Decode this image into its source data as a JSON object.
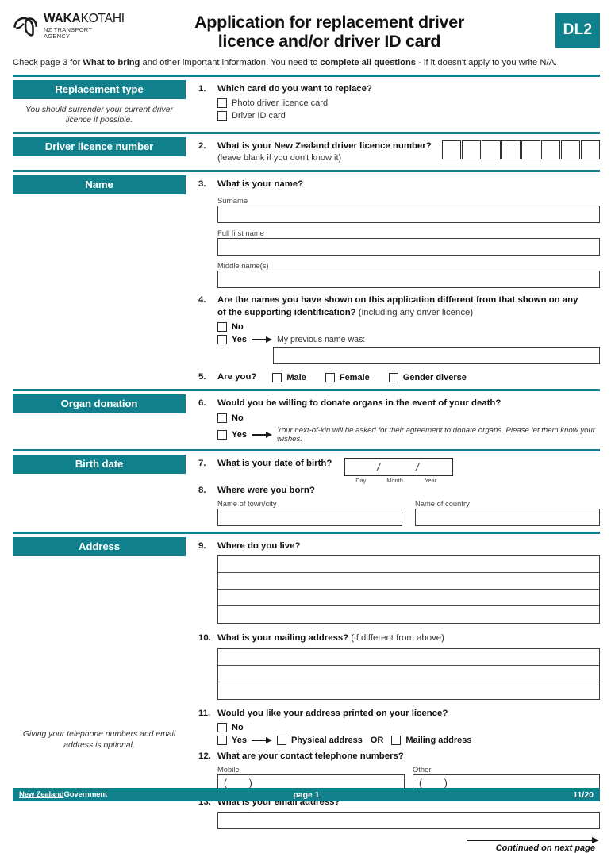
{
  "header": {
    "logo_primary": "WAKA",
    "logo_secondary": "KOTAHI",
    "logo_sub_line1": "NZ TRANSPORT",
    "logo_sub_line2": "AGENCY",
    "title_line1": "Application for replacement driver",
    "title_line2": "licence and/or driver ID card",
    "badge": "DL2",
    "intro_part1": "Check page 3 for ",
    "intro_bold1": "What to bring",
    "intro_part2": " and other important information. You need to ",
    "intro_bold2": "complete all questions",
    "intro_part3": " - if it doesn't apply to you write N/A."
  },
  "colors": {
    "teal": "#10808c",
    "box_border": "#3d3d3d",
    "text": "#1a1a1a"
  },
  "sections": {
    "replacement_type": {
      "tab": "Replacement type",
      "note": "You should surrender your current driver licence if possible."
    },
    "driver_licence_number": {
      "tab": "Driver licence number"
    },
    "name": {
      "tab": "Name"
    },
    "organ_donation": {
      "tab": "Organ donation"
    },
    "birth_date": {
      "tab": "Birth date"
    },
    "address": {
      "tab": "Address",
      "note": "Giving your telephone numbers and email address is optional."
    }
  },
  "questions": {
    "q1": {
      "num": "1.",
      "text": "Which card do you want to replace?",
      "options": [
        "Photo driver licence card",
        "Driver ID card"
      ]
    },
    "q2": {
      "num": "2.",
      "text": "What is your New Zealand driver licence number?",
      "sub": "(leave blank if you don't know it)",
      "box_count": 8
    },
    "q3": {
      "num": "3.",
      "text": "What is your name?",
      "labels": [
        "Surname",
        "Full first name",
        "Middle name(s)"
      ]
    },
    "q4": {
      "num": "4.",
      "text_line1": "Are the names you have shown on this application different from that shown on any",
      "text_line2_bold": "of the supporting identification?",
      "text_line2_reg": " (including any driver licence)",
      "option_no": "No",
      "option_yes": "Yes",
      "followup_label": "My previous name was:"
    },
    "q5": {
      "num": "5.",
      "text": "Are you?",
      "options": [
        "Male",
        "Female",
        "Gender diverse"
      ]
    },
    "q6": {
      "num": "6.",
      "text": "Would you be willing to donate organs in the event of your death?",
      "option_no": "No",
      "option_yes": "Yes",
      "yes_note": "Your next-of-kin will be asked for their agreement to donate organs. Please let them know your wishes."
    },
    "q7": {
      "num": "7.",
      "text": "What is your date of birth?",
      "separator": "/",
      "label_day": "Day",
      "label_month": "Month",
      "label_year": "Year"
    },
    "q8": {
      "num": "8.",
      "text": "Where were you born?",
      "label_town": "Name of town/city",
      "label_country": "Name of country"
    },
    "q9": {
      "num": "9.",
      "text": "Where do you live?",
      "line_count": 4
    },
    "q10": {
      "num": "10.",
      "text_bold": "What is your mailing address?",
      "text_reg": " (if different from above)",
      "line_count": 3
    },
    "q11": {
      "num": "11.",
      "text": "Would you like your address printed on your licence?",
      "option_no": "No",
      "option_yes": "Yes",
      "choice_physical": "Physical address",
      "choice_or": "OR",
      "choice_mailing": "Mailing address"
    },
    "q12": {
      "num": "12.",
      "text": "What are your contact telephone numbers?",
      "label_mobile": "Mobile",
      "label_other": "Other",
      "value_mobile": "(        )",
      "value_other": "(        )"
    },
    "q13": {
      "num": "13.",
      "text": "What is your email address?"
    }
  },
  "continued": {
    "text": "Continued on next page"
  },
  "footer": {
    "gov_underlined": "New Zealand",
    "gov_rest": "Government",
    "page": "page 1",
    "version": "11/20"
  }
}
